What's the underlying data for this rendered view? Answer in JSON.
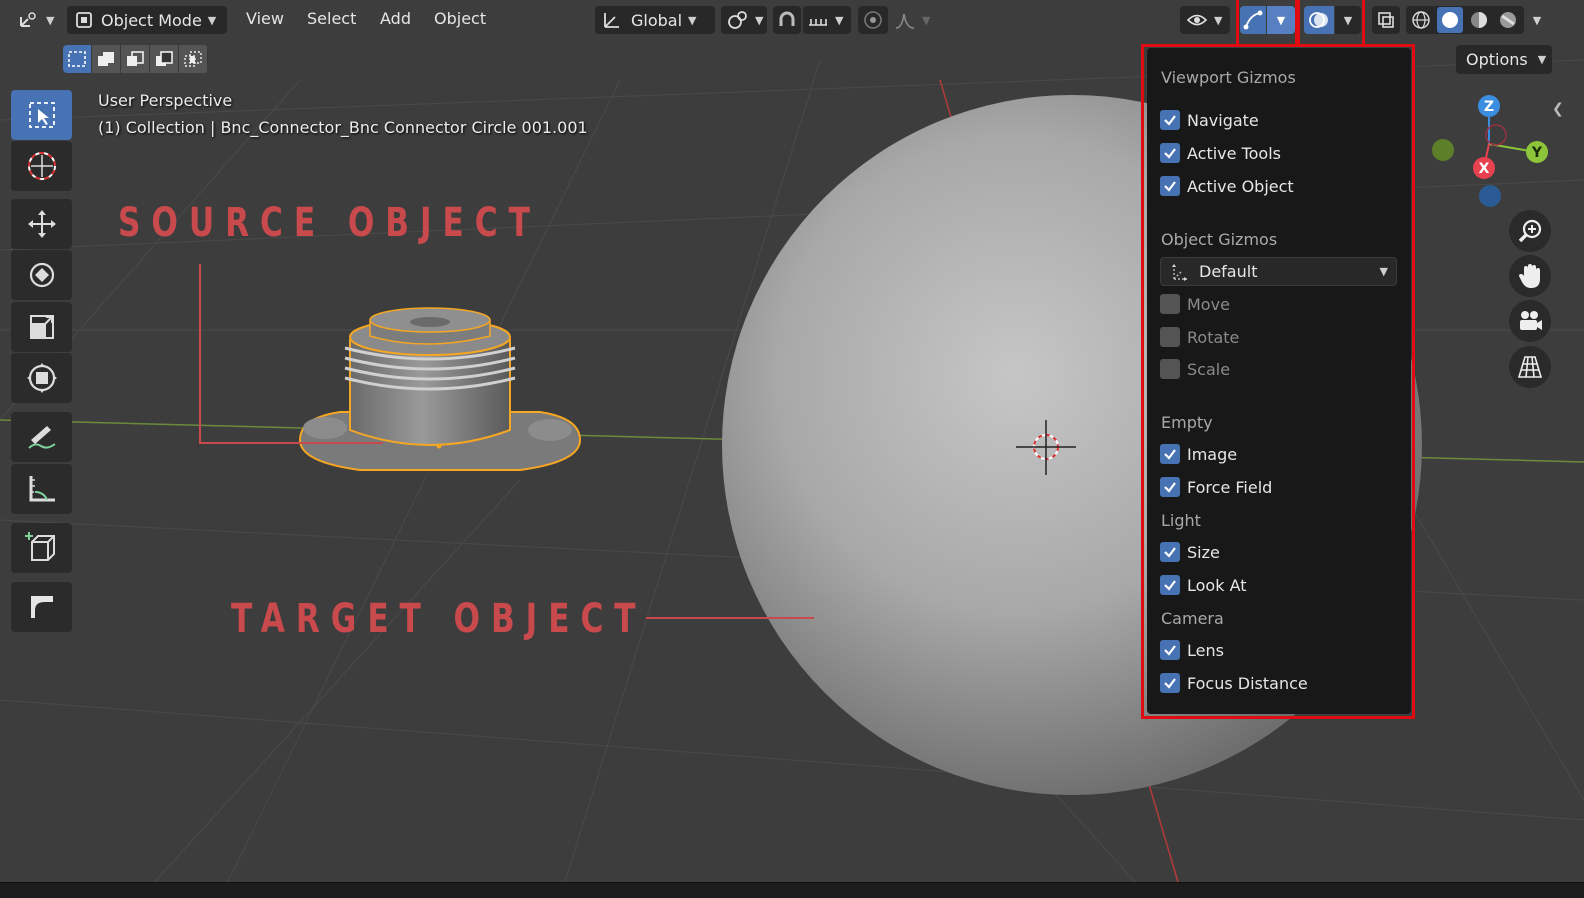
{
  "header": {
    "mode_label": "Object Mode",
    "menus": [
      "View",
      "Select",
      "Add",
      "Object"
    ],
    "transform_orientation": "Global",
    "options_label": "Options"
  },
  "viewport": {
    "perspective_label": "User Perspective",
    "collection_label": "(1) Collection | Bnc_Connector_Bnc Connector Circle 001.001"
  },
  "annotations": {
    "source": "SOURCE OBJECT",
    "target": "TARGET OBJECT"
  },
  "gizmo_axes": {
    "z": "Z",
    "y": "Y",
    "x": "X"
  },
  "popover": {
    "viewport_gizmos_title": "Viewport Gizmos",
    "viewport_gizmos": [
      {
        "label": "Navigate",
        "checked": true
      },
      {
        "label": "Active Tools",
        "checked": true
      },
      {
        "label": "Active Object",
        "checked": true
      }
    ],
    "object_gizmos_title": "Object Gizmos",
    "object_gizmos_dropdown": "Default",
    "object_gizmos": [
      {
        "label": "Move",
        "checked": false
      },
      {
        "label": "Rotate",
        "checked": false
      },
      {
        "label": "Scale",
        "checked": false
      }
    ],
    "empty_title": "Empty",
    "empty": [
      {
        "label": "Image",
        "checked": true
      },
      {
        "label": "Force Field",
        "checked": true
      }
    ],
    "light_title": "Light",
    "light": [
      {
        "label": "Size",
        "checked": true
      },
      {
        "label": "Look At",
        "checked": true
      }
    ],
    "camera_title": "Camera",
    "camera": [
      {
        "label": "Lens",
        "checked": true
      },
      {
        "label": "Focus Distance",
        "checked": true
      }
    ]
  },
  "colors": {
    "accent": "#4772b3",
    "highlight_box": "#e00c12",
    "annotation": "#c94a4c",
    "selection_outline": "#f5a623"
  }
}
